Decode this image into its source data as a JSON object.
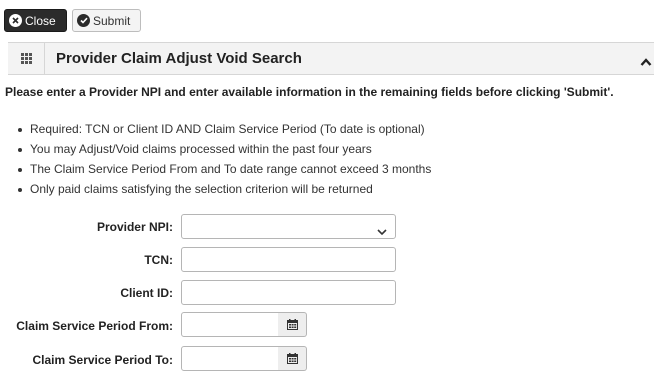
{
  "toolbar": {
    "close_label": "Close",
    "submit_label": "Submit"
  },
  "panel": {
    "title": "Provider Claim Adjust Void Search"
  },
  "instruction": "Please enter a Provider NPI and enter available information in the remaining fields before clicking 'Submit'.",
  "rules": [
    "Required: TCN or Client ID AND Claim Service Period (To date is optional)",
    "You may Adjust/Void claims processed within the past four years",
    "The Claim Service Period From and To date range cannot exceed 3 months",
    "Only paid claims satisfying the selection criterion will be returned"
  ],
  "form": {
    "provider_npi": {
      "label": "Provider NPI:",
      "value": ""
    },
    "tcn": {
      "label": "TCN:",
      "value": ""
    },
    "client_id": {
      "label": "Client ID:",
      "value": ""
    },
    "period_from": {
      "label": "Claim Service Period From:",
      "value": ""
    },
    "period_to": {
      "label": "Claim Service Period To:",
      "value": ""
    }
  },
  "icons": {
    "close": "close-circle-icon",
    "submit": "check-circle-icon",
    "panel_grid": "grid-icon",
    "collapse": "chevron-up-icon",
    "dropdown": "chevron-down-icon",
    "calendar": "calendar-icon"
  },
  "colors": {
    "close_button_bg": "#2b2b2b",
    "panel_header_bg": "#f3f3f3",
    "border": "#b5b5b5"
  }
}
